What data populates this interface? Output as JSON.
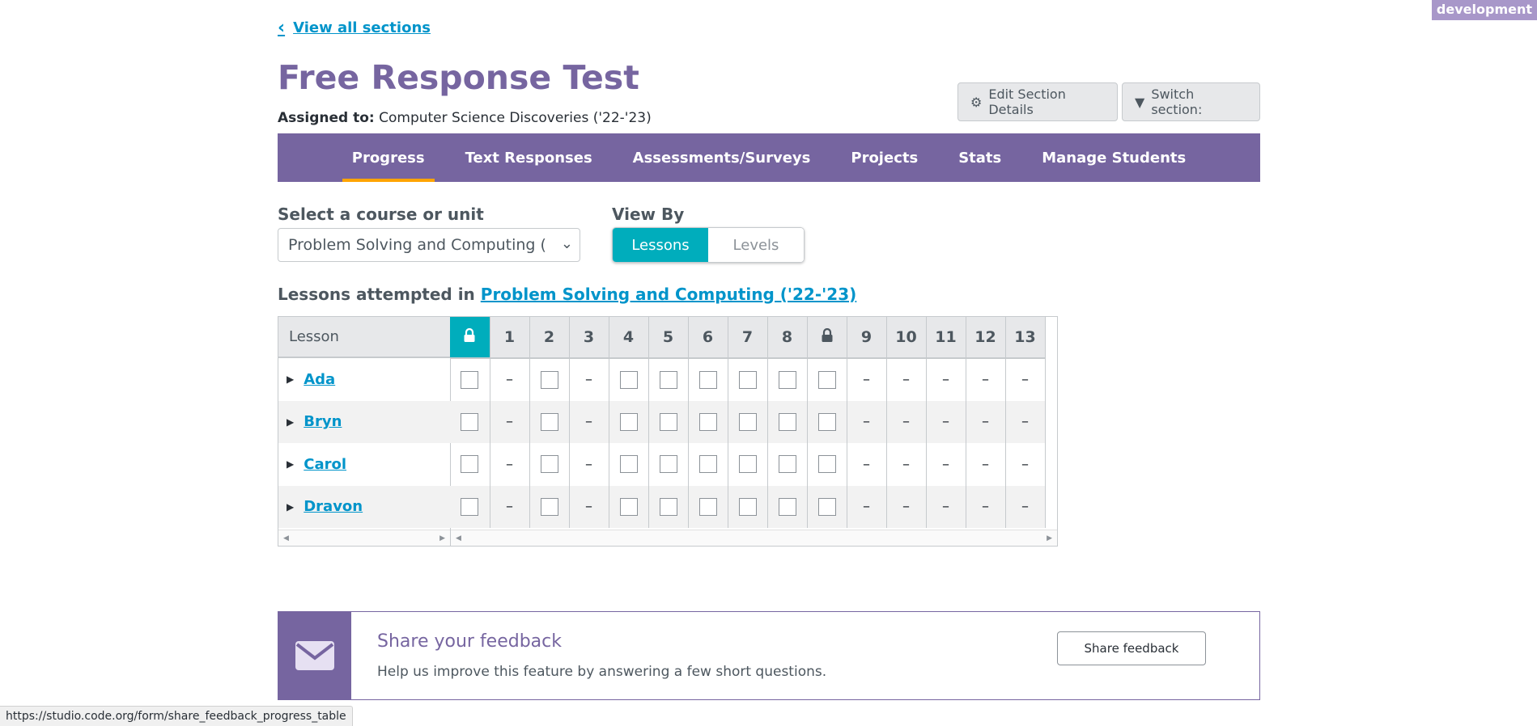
{
  "env_badge": "development",
  "back_link": "View all sections",
  "title": "Free Response Test",
  "assigned_label": "Assigned to:",
  "assigned_value": "Computer Science Discoveries ('22-'23)",
  "buttons": {
    "edit": "Edit Section Details",
    "switch": "Switch section:"
  },
  "tabs": [
    "Progress",
    "Text Responses",
    "Assessments/Surveys",
    "Projects",
    "Stats",
    "Manage Students"
  ],
  "active_tab": "Progress",
  "course_label": "Select a course or unit",
  "course_value": "Problem Solving and Computing (",
  "viewby_label": "View By",
  "viewby_options": {
    "lessons": "Lessons",
    "levels": "Levels"
  },
  "attempted_prefix": "Lessons attempted in",
  "attempted_link": "Problem Solving and Computing ('22-'23)",
  "table": {
    "lesson_header": "Lesson",
    "columns": [
      "lock",
      "1",
      "2",
      "3",
      "4",
      "5",
      "6",
      "7",
      "8",
      "lock",
      "9",
      "10",
      "11",
      "12",
      "13"
    ],
    "cell_types": [
      "box",
      "dash",
      "box",
      "dash",
      "box",
      "box",
      "box",
      "box",
      "box",
      "box",
      "dash",
      "dash",
      "dash",
      "dash",
      "dash"
    ],
    "dash_text": "–",
    "students": [
      "Ada",
      "Bryn",
      "Carol",
      "Dravon"
    ]
  },
  "feedback": {
    "title": "Share your feedback",
    "text": "Help us improve this feature by answering a few short questions.",
    "button": "Share feedback"
  },
  "status_url": "https://studio.code.org/form/share_feedback_progress_table",
  "colors": {
    "brand_purple": "#7665a0",
    "teal": "#00adbc",
    "link": "#0094ca",
    "active_underline": "#ffa400"
  }
}
